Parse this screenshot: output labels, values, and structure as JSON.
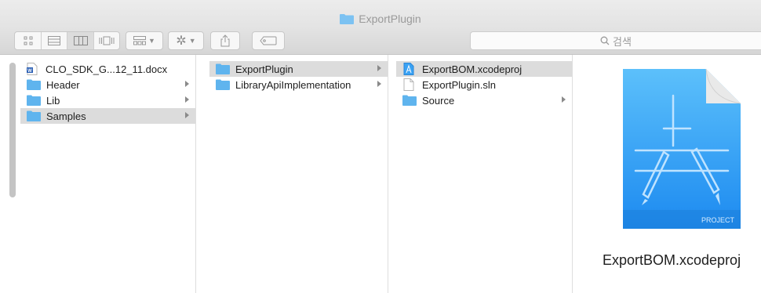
{
  "window": {
    "title": "ExportPlugin"
  },
  "toolbar": {
    "view_modes": [
      "icon-view",
      "list-view",
      "column-view",
      "cover-flow-view"
    ],
    "arrange_icon": "arrange-icon",
    "action_icon": "gear-icon",
    "share_icon": "share-icon",
    "tag_icon": "tag-icon",
    "search_placeholder": "검색"
  },
  "columns": [
    {
      "items": [
        {
          "name": "CLO_SDK_G...12_11.docx",
          "kind": "word-document",
          "has_children": false,
          "selected": false
        },
        {
          "name": "Header",
          "kind": "folder",
          "has_children": true,
          "selected": false
        },
        {
          "name": "Lib",
          "kind": "folder",
          "has_children": true,
          "selected": false
        },
        {
          "name": "Samples",
          "kind": "folder",
          "has_children": true,
          "selected": true
        }
      ]
    },
    {
      "items": [
        {
          "name": "ExportPlugin",
          "kind": "folder",
          "has_children": true,
          "selected": true
        },
        {
          "name": "LibraryApiImplementation",
          "kind": "folder",
          "has_children": true,
          "selected": false
        }
      ]
    },
    {
      "items": [
        {
          "name": "ExportBOM.xcodeproj",
          "kind": "xcode-project",
          "has_children": false,
          "selected": true
        },
        {
          "name": "ExportPlugin.sln",
          "kind": "document",
          "has_children": false,
          "selected": false
        },
        {
          "name": "Source",
          "kind": "folder",
          "has_children": true,
          "selected": false
        }
      ]
    }
  ],
  "preview": {
    "file_name": "ExportBOM.xcodeproj",
    "icon": "xcode-project-icon",
    "icon_label": "PROJECT"
  },
  "colors": {
    "folder": "#5fb4ee",
    "selection": "#dcdcdc",
    "project_icon": "#3aa2f4"
  }
}
